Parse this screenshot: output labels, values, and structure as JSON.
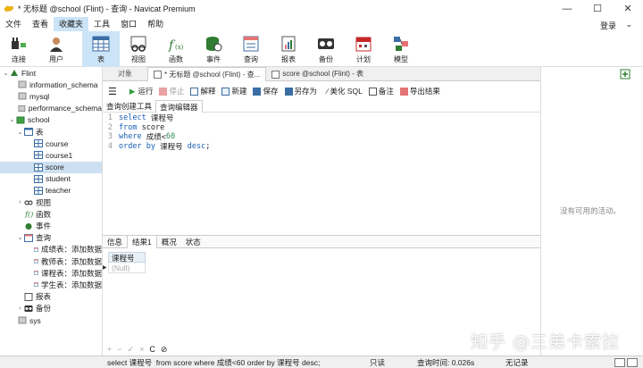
{
  "window": {
    "title": "* 无标题 @school (Flint) - 查询 - Navicat Premium"
  },
  "menu": [
    "文件",
    "查看",
    "收藏夹",
    "工具",
    "窗口",
    "帮助"
  ],
  "login_label": "登录",
  "toolbar": [
    {
      "label": "连接",
      "icon": "plug-icon"
    },
    {
      "label": "用户",
      "icon": "user-icon"
    },
    {
      "label": "表",
      "icon": "table-icon"
    },
    {
      "label": "视图",
      "icon": "view-icon"
    },
    {
      "label": "函数",
      "icon": "function-icon"
    },
    {
      "label": "事件",
      "icon": "event-icon"
    },
    {
      "label": "查询",
      "icon": "query-icon"
    },
    {
      "label": "报表",
      "icon": "report-icon"
    },
    {
      "label": "备份",
      "icon": "backup-icon"
    },
    {
      "label": "计划",
      "icon": "calendar-icon"
    },
    {
      "label": "模型",
      "icon": "model-icon"
    }
  ],
  "tree": [
    {
      "label": "Flint",
      "level": 0
    },
    {
      "label": "information_schema",
      "level": 1
    },
    {
      "label": "mysql",
      "level": 1
    },
    {
      "label": "performance_schema",
      "level": 1
    },
    {
      "label": "school",
      "level": 1
    },
    {
      "label": "表",
      "level": 2
    },
    {
      "label": "course",
      "level": 3
    },
    {
      "label": "course1",
      "level": 3
    },
    {
      "label": "score",
      "level": 3
    },
    {
      "label": "student",
      "level": 3
    },
    {
      "label": "teacher",
      "level": 3
    },
    {
      "label": "视图",
      "level": 2
    },
    {
      "label": "函数",
      "level": 2
    },
    {
      "label": "事件",
      "level": 2
    },
    {
      "label": "查询",
      "level": 2
    },
    {
      "label": "成绩表：添加数据",
      "level": 3
    },
    {
      "label": "教师表：添加数据",
      "level": 3
    },
    {
      "label": "课程表：添加数据",
      "level": 3
    },
    {
      "label": "学生表：添加数据",
      "level": 3
    },
    {
      "label": "报表",
      "level": 2
    },
    {
      "label": "备份",
      "level": 2
    },
    {
      "label": "sys",
      "level": 1
    }
  ],
  "tabs": {
    "objects": "对象",
    "query_tab": "* 无标题 @school (Flint) - 查...",
    "table_tab": "score @school (Flint) - 表"
  },
  "query_toolbar": {
    "run": "运行",
    "stop": "停止",
    "explain": "解释",
    "new": "新建",
    "save": "保存",
    "save_as": "另存为",
    "beautify": "美化 SQL",
    "note": "备注",
    "export": "导出结果"
  },
  "sub_tabs": [
    "查询创建工具",
    "查询编辑器"
  ],
  "sql_lines": [
    {
      "n": "1",
      "kw": "select",
      "rest": " 课程号"
    },
    {
      "n": "2",
      "kw": "from",
      "rest": " score"
    },
    {
      "n": "3",
      "kw": "where",
      "rest": " 成绩<",
      "num": "60"
    },
    {
      "n": "4",
      "kw": "order by",
      "rest": " 课程号 ",
      "kw2": "desc",
      "tail": ";"
    }
  ],
  "result_tabs": [
    "信息",
    "结果1",
    "概况",
    "状态"
  ],
  "result": {
    "column": "课程号",
    "value": "(Null)"
  },
  "nav_icons": [
    "+",
    "−",
    "✓",
    "×",
    "C",
    "⊘"
  ],
  "right_panel": {
    "message": "没有可用的活动。"
  },
  "watermark": "知乎 @三弟卡索拉",
  "status": {
    "sql": "select 课程号  from score where 成绩<60 order by 课程号 desc;",
    "readonly": "只读",
    "query_time": "查询时间: 0.026s",
    "records": "无记录"
  }
}
